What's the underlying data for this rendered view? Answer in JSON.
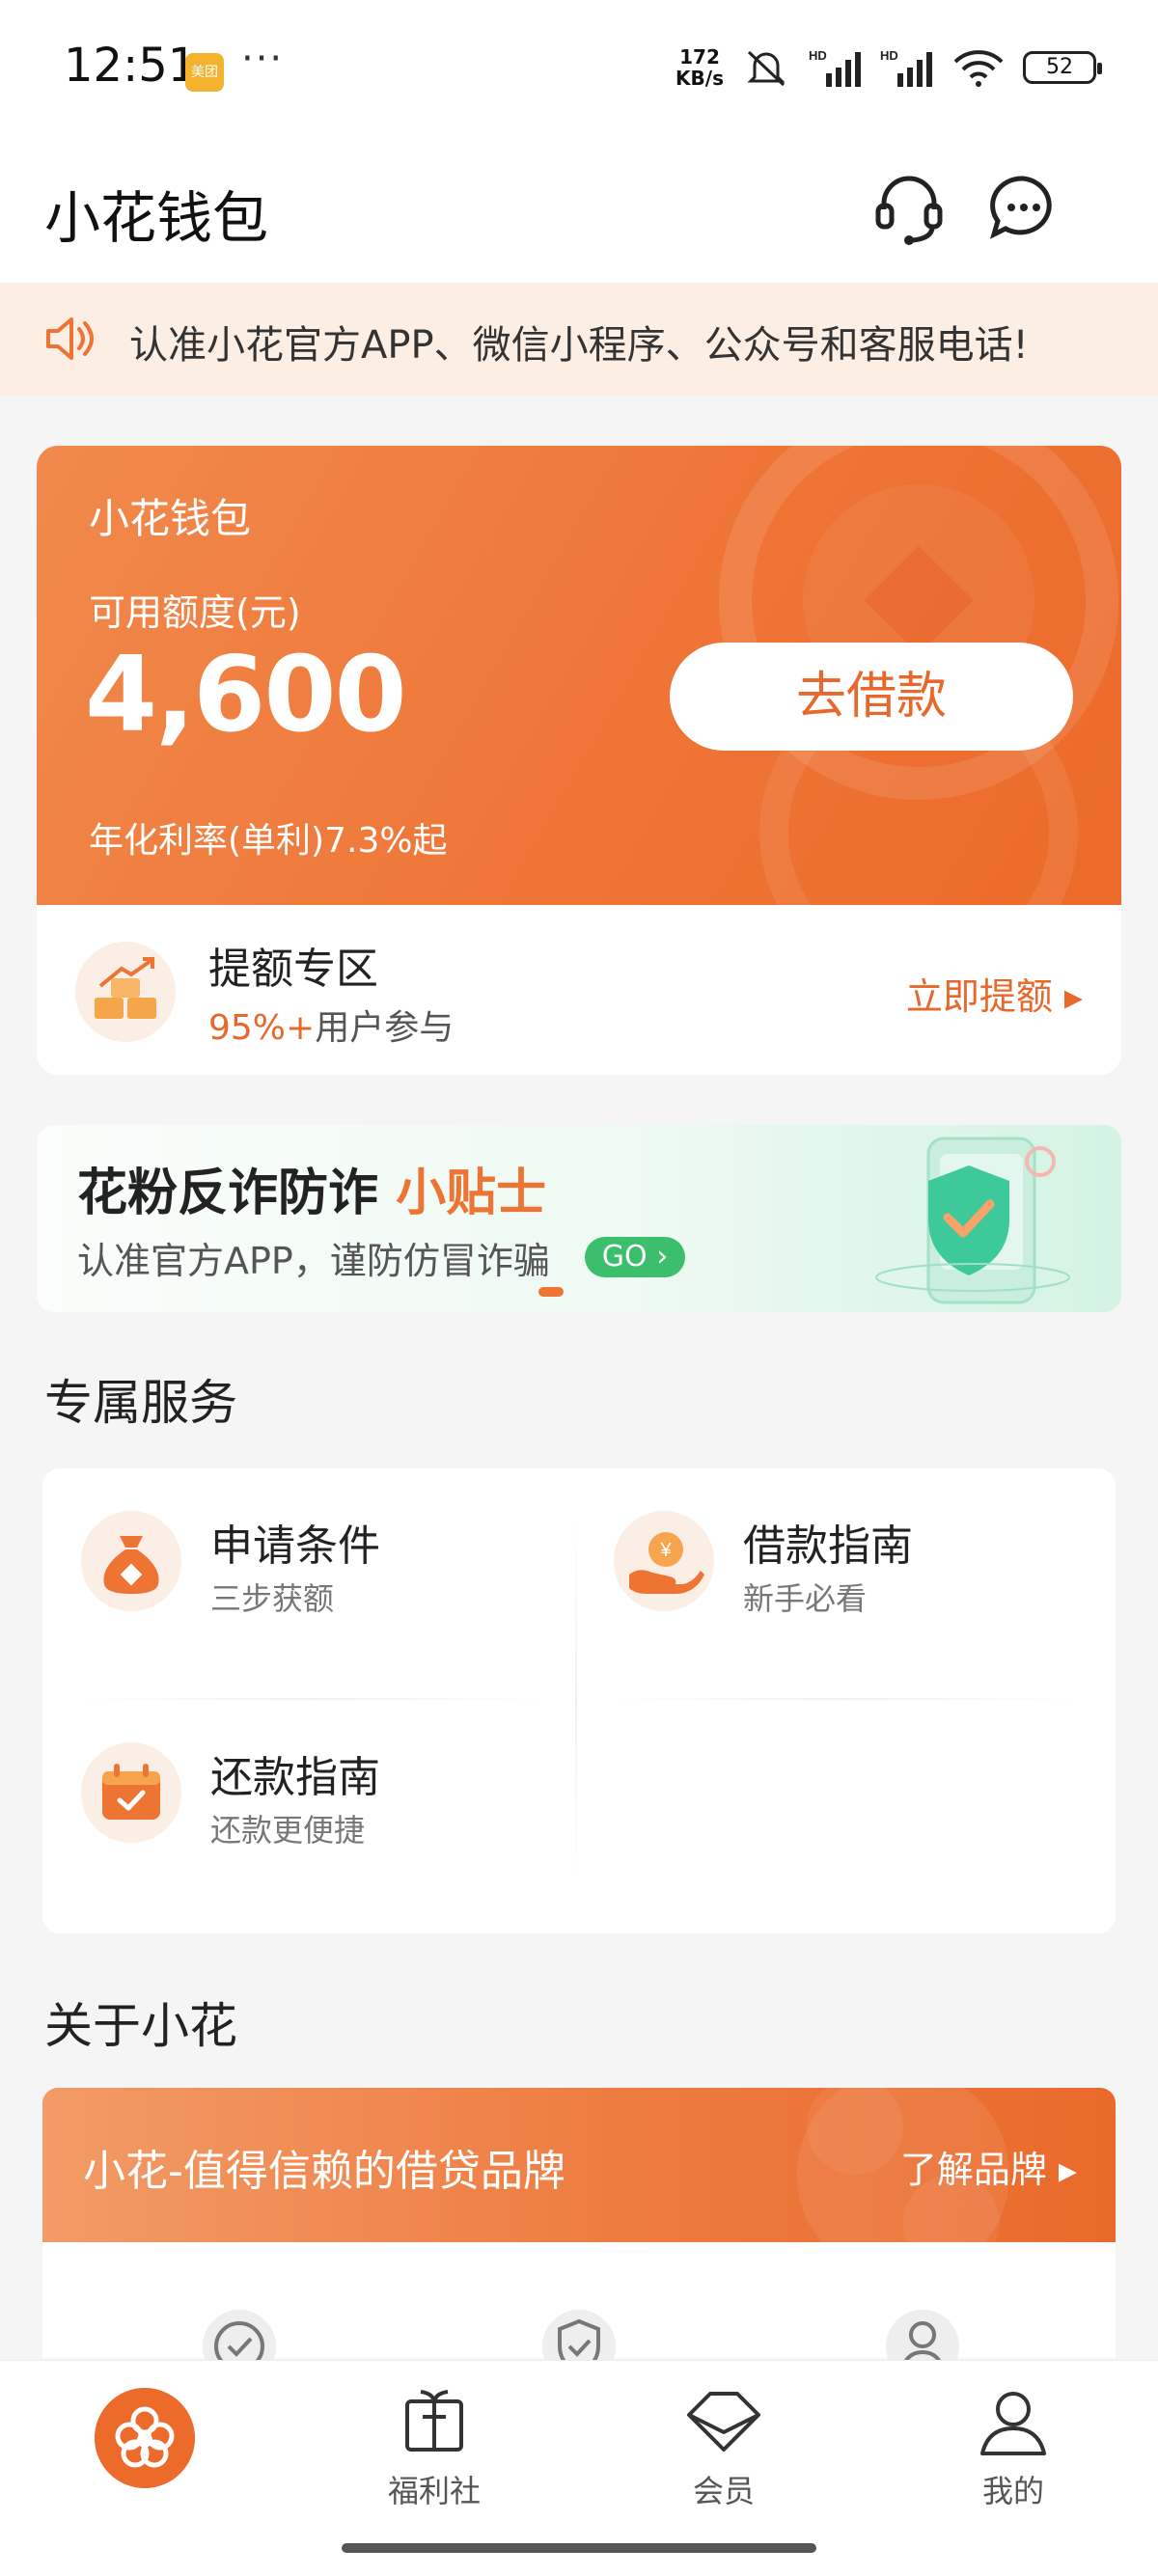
{
  "status_bar": {
    "time": "12:51",
    "app_badge": "美团",
    "more": "···",
    "net_speed_value": "172",
    "net_speed_unit": "KB/s",
    "battery": "52"
  },
  "header": {
    "title": "小花钱包",
    "icons": [
      "headset-icon",
      "message-icon"
    ]
  },
  "notice": {
    "text": "认准小花官方APP、微信小程序、公众号和客服电话!"
  },
  "wallet": {
    "name": "小花钱包",
    "available_label": "可用额度(元)",
    "amount": "4,600",
    "rate_text": "年化利率(单利)7.3%起",
    "borrow_button": "去借款",
    "accent": "#ef7537"
  },
  "quota": {
    "title": "提额专区",
    "sub_highlight": "95%+",
    "sub_rest": "用户参与",
    "link": "立即提额 ▸"
  },
  "anti_fraud": {
    "title_main": "花粉反诈防诈",
    "title_highlight": "小贴士",
    "subtitle": "认准官方APP，谨防仿冒诈骗",
    "go": "GO ›"
  },
  "services": {
    "heading": "专属服务",
    "items": [
      {
        "title": "申请条件",
        "sub": "三步获额",
        "icon": "money-bag-icon"
      },
      {
        "title": "借款指南",
        "sub": "新手必看",
        "icon": "coin-hand-icon"
      },
      {
        "title": "还款指南",
        "sub": "还款更便捷",
        "icon": "calendar-check-icon"
      }
    ]
  },
  "about": {
    "heading": "关于小花",
    "brand_text": "小花-值得信赖的借贷品牌",
    "brand_link": "了解品牌 ▸"
  },
  "bottom_nav": {
    "items": [
      {
        "label": "",
        "icon": "flower-home-icon"
      },
      {
        "label": "福利社",
        "icon": "gift-icon"
      },
      {
        "label": "会员",
        "icon": "diamond-icon"
      },
      {
        "label": "我的",
        "icon": "user-icon"
      }
    ]
  }
}
